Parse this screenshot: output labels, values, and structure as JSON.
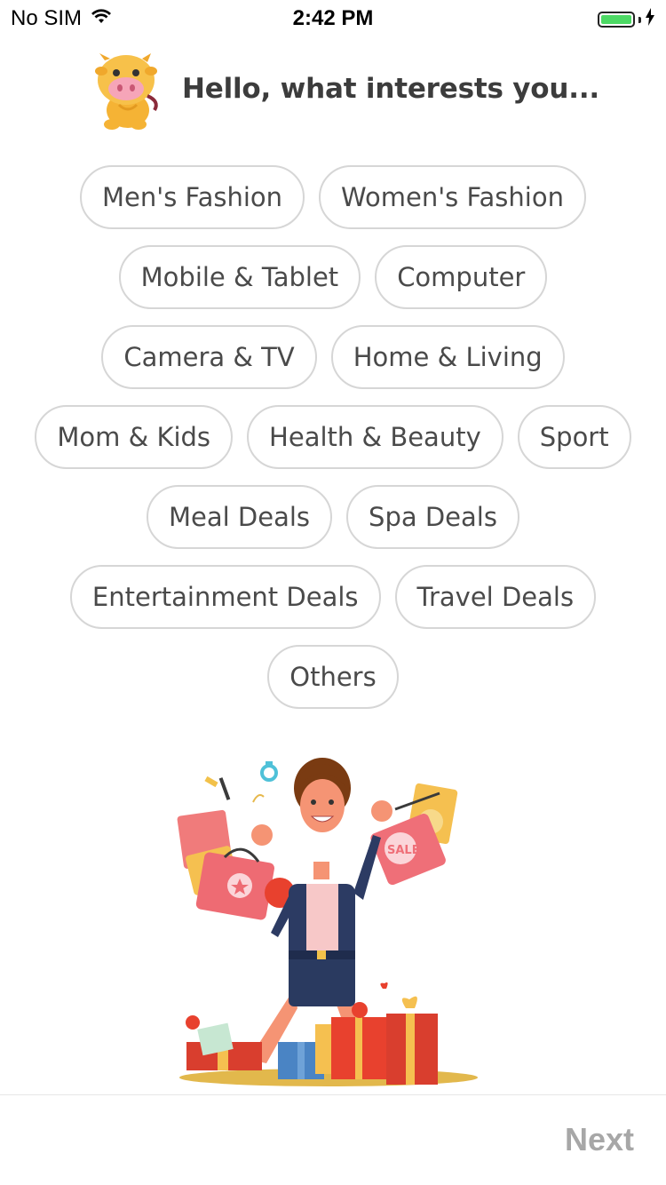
{
  "status_bar": {
    "carrier": "No SIM",
    "time": "2:42 PM"
  },
  "header": {
    "greeting": "Hello, what interests you..."
  },
  "chip_rows": [
    [
      "Men's Fashion",
      "Women's Fashion"
    ],
    [
      "Mobile & Tablet",
      "Computer"
    ],
    [
      "Camera & TV",
      "Home & Living"
    ],
    [
      "Mom & Kids",
      "Health & Beauty",
      "Sport"
    ],
    [
      "Meal Deals",
      "Spa Deals"
    ],
    [
      "Entertainment Deals",
      "Travel Deals"
    ],
    [
      "Others"
    ]
  ],
  "illustration": {
    "tag_text": "SALE"
  },
  "footer": {
    "next_label": "Next"
  },
  "colors": {
    "battery": "#4cd964",
    "chip_border": "#d6d6d6",
    "next_disabled": "#a7a7a7"
  }
}
